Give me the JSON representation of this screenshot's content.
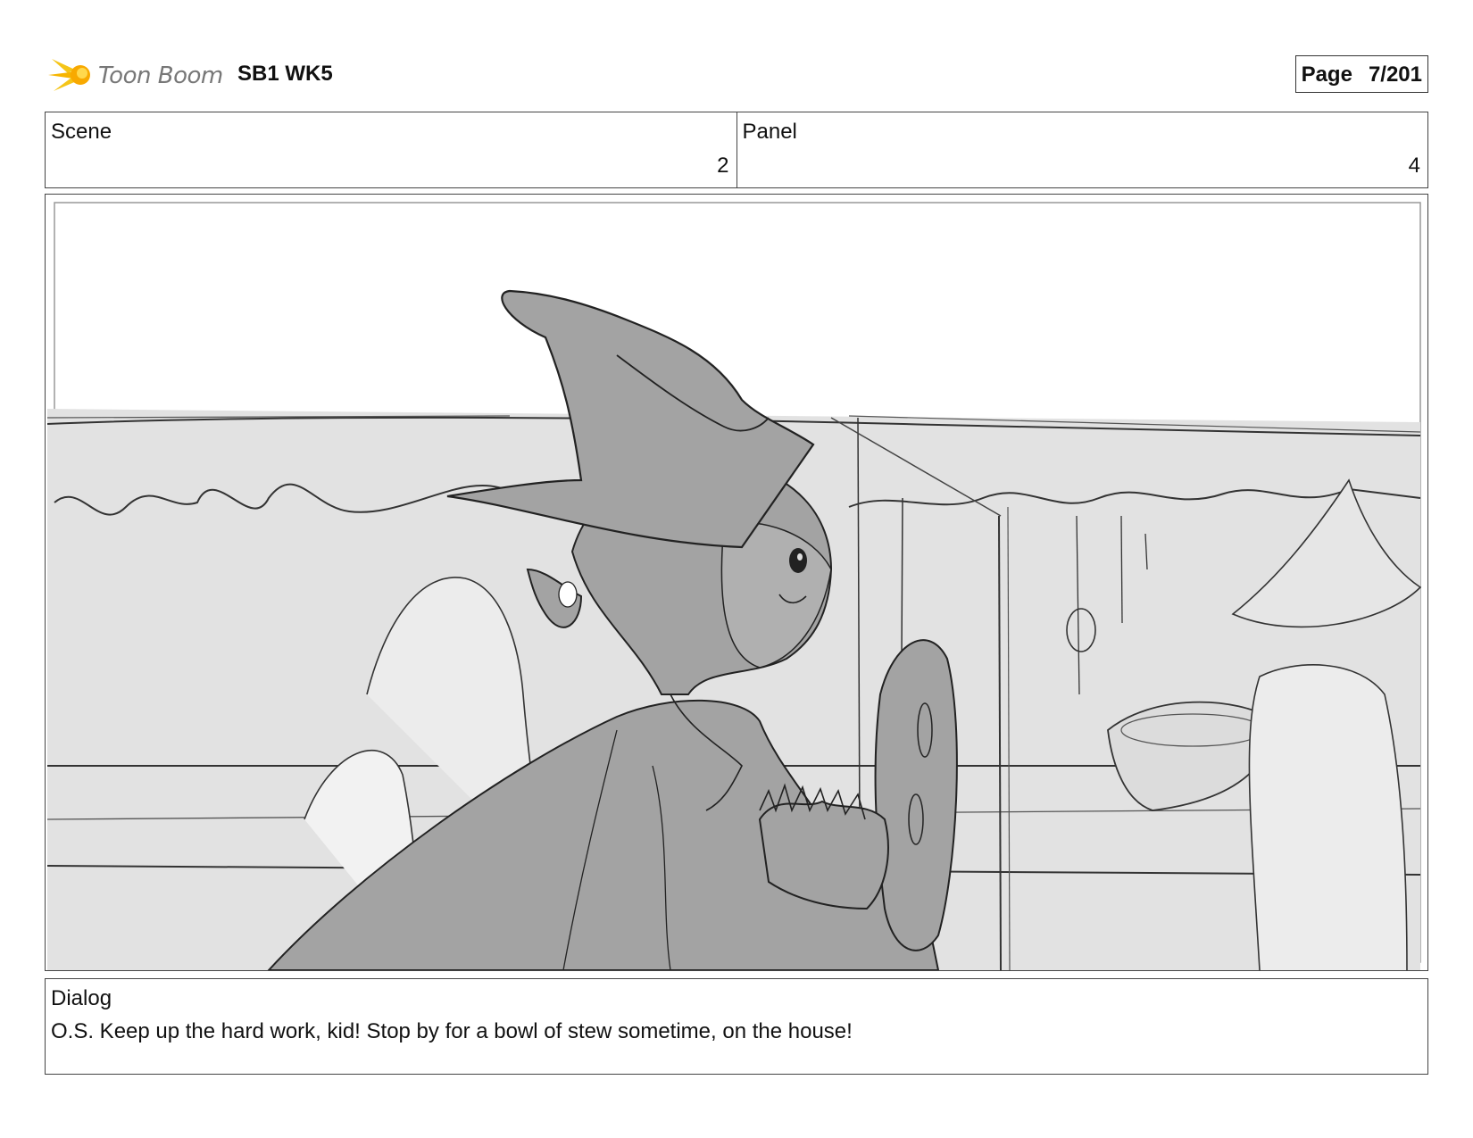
{
  "header": {
    "logo_text": "Toon Boom",
    "doc_title": "SB1 WK5",
    "page_label": "Page",
    "page_number": "7/201"
  },
  "scene": {
    "label": "Scene",
    "value": "2"
  },
  "panel": {
    "label": "Panel",
    "value": "4"
  },
  "dialog": {
    "label": "Dialog",
    "text": "O.S. Keep up the hard work, kid! Stop by for a bowl of stew sometime, on the house!"
  },
  "colors": {
    "background": "#ffffff",
    "border": "#444444",
    "sketch_fill_light": "#e2e2e2",
    "sketch_fill_dark": "#a3a3a3",
    "logo_accent": "#f5c518"
  },
  "icons": [
    "toon-boom-logo-icon"
  ]
}
